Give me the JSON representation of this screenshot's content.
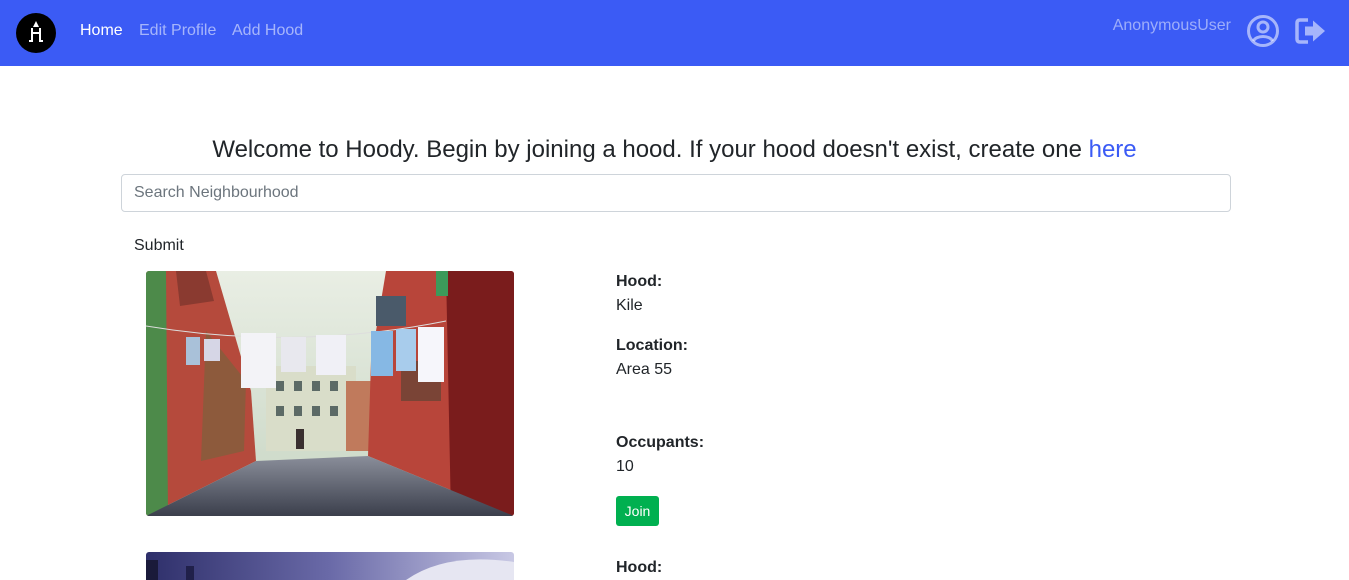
{
  "nav": {
    "links": [
      "Home",
      "Edit Profile",
      "Add Hood"
    ],
    "username": "AnonymousUser",
    "icons": [
      "brand-logo-icon",
      "user-circle-icon",
      "sign-out-icon"
    ]
  },
  "main": {
    "welcome_text": "Welcome to Hoody. Begin by joining a hood. If your hood doesn't exist, create one ",
    "welcome_link": "here",
    "search_placeholder": "Search Neighbourhood",
    "submit_label": "Submit"
  },
  "labels": {
    "hood": "Hood:",
    "location": "Location:",
    "occupants": "Occupants:"
  },
  "hoods": [
    {
      "name": "Kile",
      "location": "Area 55",
      "occupants": "10",
      "join_label": "Join"
    },
    {}
  ],
  "colors": {
    "navbar": "#3b5bf5",
    "link": "#3b5bf5",
    "join_button": "#00b050"
  }
}
